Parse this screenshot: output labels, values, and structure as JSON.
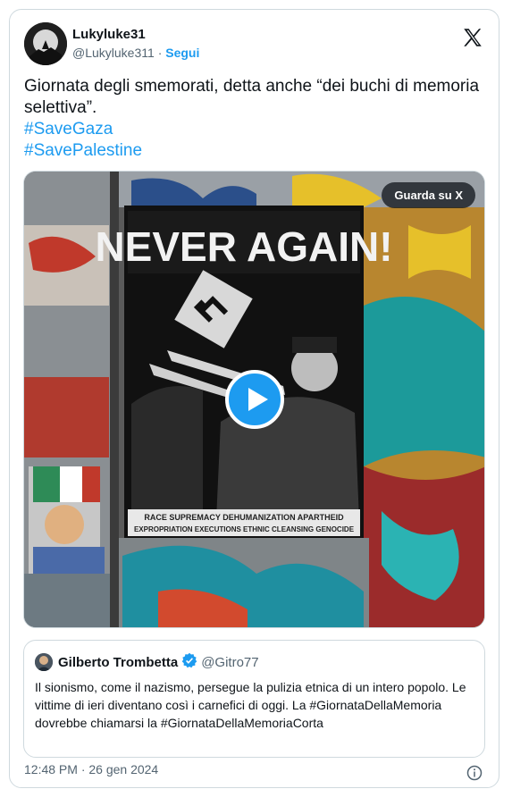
{
  "tweet": {
    "author_name": "Lukyluke31",
    "author_handle": "@Lukyluke311",
    "separator": "·",
    "follow_label": "Segui",
    "text": "Giornata degli smemorati, detta anche “dei buchi di memoria selettiva”.",
    "hashtags": [
      "#SaveGaza",
      "#SavePalestine"
    ],
    "timestamp": "12:48 PM · 26 gen 2024"
  },
  "media": {
    "watch_label": "Guarda su X",
    "poster_headline": "NEVER AGAIN!",
    "poster_caption_line1": "RACE SUPREMACY   DEHUMANIZATION   APARTHEID",
    "poster_caption_line2": "EXPROPRIATION   EXECUTIONS   ETHNIC CLEANSING   GENOCIDE"
  },
  "quote": {
    "author_name": "Gilberto Trombetta",
    "author_handle": "@Gitro77",
    "text": "Il sionismo, come il nazismo, persegue la pulizia etnica di un intero popolo. Le vittime di ieri diventano così i carnefici di oggi. La #GiornataDellaMemoria dovrebbe chiamarsi la #GiornataDellaMemoriaCorta"
  },
  "icons": {
    "platform": "x-logo-icon",
    "verified": "verified-badge-icon",
    "play": "play-icon",
    "info": "info-icon"
  },
  "colors": {
    "accent": "#1d9bf0",
    "text": "#0f1419",
    "muted": "#536471",
    "border": "#cfd9de"
  }
}
